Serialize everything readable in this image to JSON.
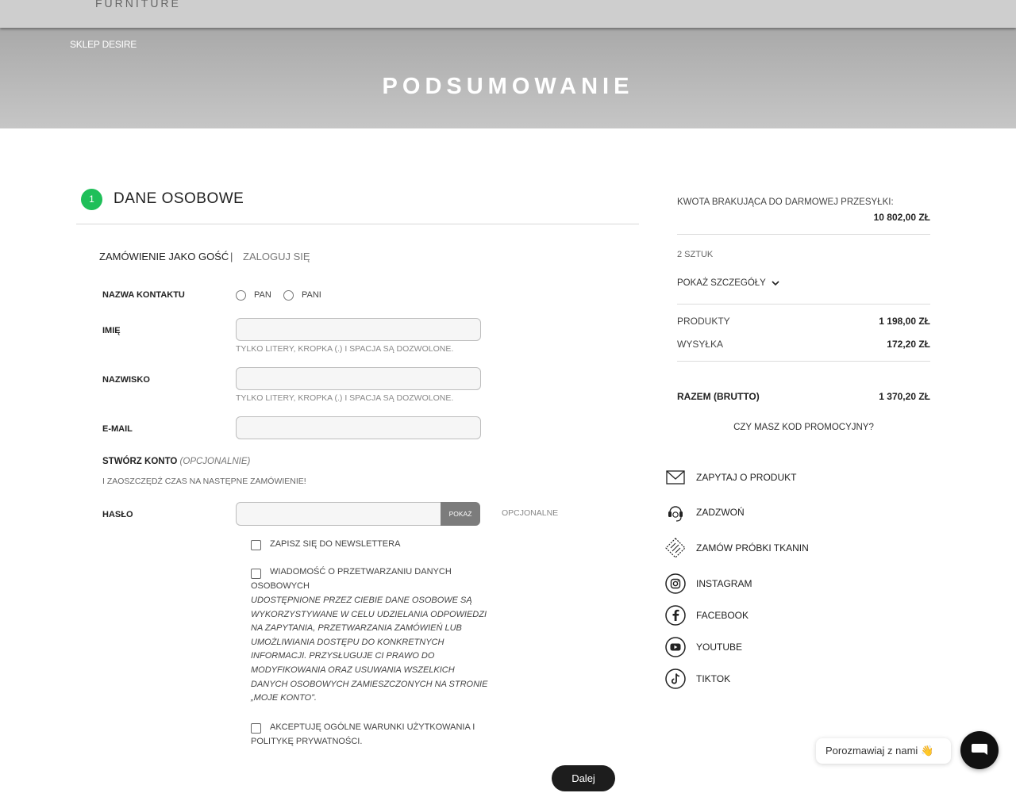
{
  "header": {
    "logo_text": "FURNITURE",
    "breadcrumb": "SKLEP DESIRE",
    "page_title": "PODSUMOWANIE"
  },
  "step": {
    "number": "1",
    "title": "DANE OSOBOWE"
  },
  "mode": {
    "guest": "ZAMÓWIENIE JAKO GOŚĆ",
    "separator": "|",
    "login": "ZALOGUJ SIĘ"
  },
  "form": {
    "contact_label": "NAZWA KONTAKTU",
    "radio_pan": "PAN",
    "radio_pani": "PANI",
    "first_name_label": "IMIĘ",
    "first_name_hint": "TYLKO LITERY, KROPKA (.) I SPACJA SĄ DOZWOLONE.",
    "last_name_label": "NAZWISKO",
    "last_name_hint": "TYLKO LITERY, KROPKA (.) I SPACJA SĄ DOZWOLONE.",
    "email_label": "E-MAIL",
    "create_account": "STWÓRZ KONTO",
    "create_account_optional": "(OPCJONALNIE)",
    "create_account_sub": "I ZAOSZCZĘDŹ CZAS NA NASTĘPNE ZAMÓWIENIE!",
    "password_label": "HASŁO",
    "show_button": "POKAŻ",
    "password_optional": "OPCJONALNE",
    "newsletter": "ZAPISZ SIĘ DO NEWSLETTERA",
    "data_processing": "WIADOMOŚĆ O PRZETWARZANIU DANYCH OSOBOWYCH",
    "data_processing_desc": "UDOSTĘPNIONE PRZEZ CIEBIE DANE OSOBOWE SĄ WYKORZYSTYWANE W CELU UDZIELANIA ODPOWIEDZI NA ZAPYTANIA, PRZETWARZANIA ZAMÓWIEŃ LUB UMOŻLIWIANIA DOSTĘPU DO KONKRETNYCH INFORMACJI. PRZYSŁUGUJE CI PRAWO DO MODYFIKOWANIA ORAZ USUWANIA WSZELKICH DANYCH OSOBOWYCH ZAMIESZCZONYCH NA STRONIE „MOJE KONTO”.",
    "terms": "AKCEPTUJĘ OGÓLNE WARUNKI UŻYTKOWANIA I POLITYKĘ PRYWATNOŚCI.",
    "next_button": "Dalej"
  },
  "summary": {
    "free_shipping_label": "KWOTA BRAKUJĄCA DO DARMOWEJ PRZESYŁKI:",
    "free_shipping_value": "10 802,00 ZŁ",
    "items_count": "2 SZTUK",
    "show_details": "POKAŻ SZCZEGÓŁY",
    "products_label": "PRODUKTY",
    "products_value": "1 198,00 ZŁ",
    "shipping_label": "WYSYŁKA",
    "shipping_value": "172,20 ZŁ",
    "total_label": "RAZEM (BRUTTO)",
    "total_value": "1 370,20 ZŁ",
    "promo": "CZY MASZ KOD PROMOCYJNY?"
  },
  "contacts": {
    "ask_product": "ZAPYTAJ O PRODUKT",
    "call": "ZADZWOŃ",
    "order_samples": "ZAMÓW PRÓBKI TKANIN",
    "instagram": "INSTAGRAM",
    "facebook": "FACEBOOK",
    "youtube": "YOUTUBE",
    "tiktok": "TIKTOK"
  },
  "chat": {
    "label": "Porozmawiaj z nami",
    "emoji": "👋"
  },
  "colors": {
    "accent_green": "#1fbf59",
    "button_dark": "#1d1d1d",
    "header_gray": "#cecece"
  }
}
